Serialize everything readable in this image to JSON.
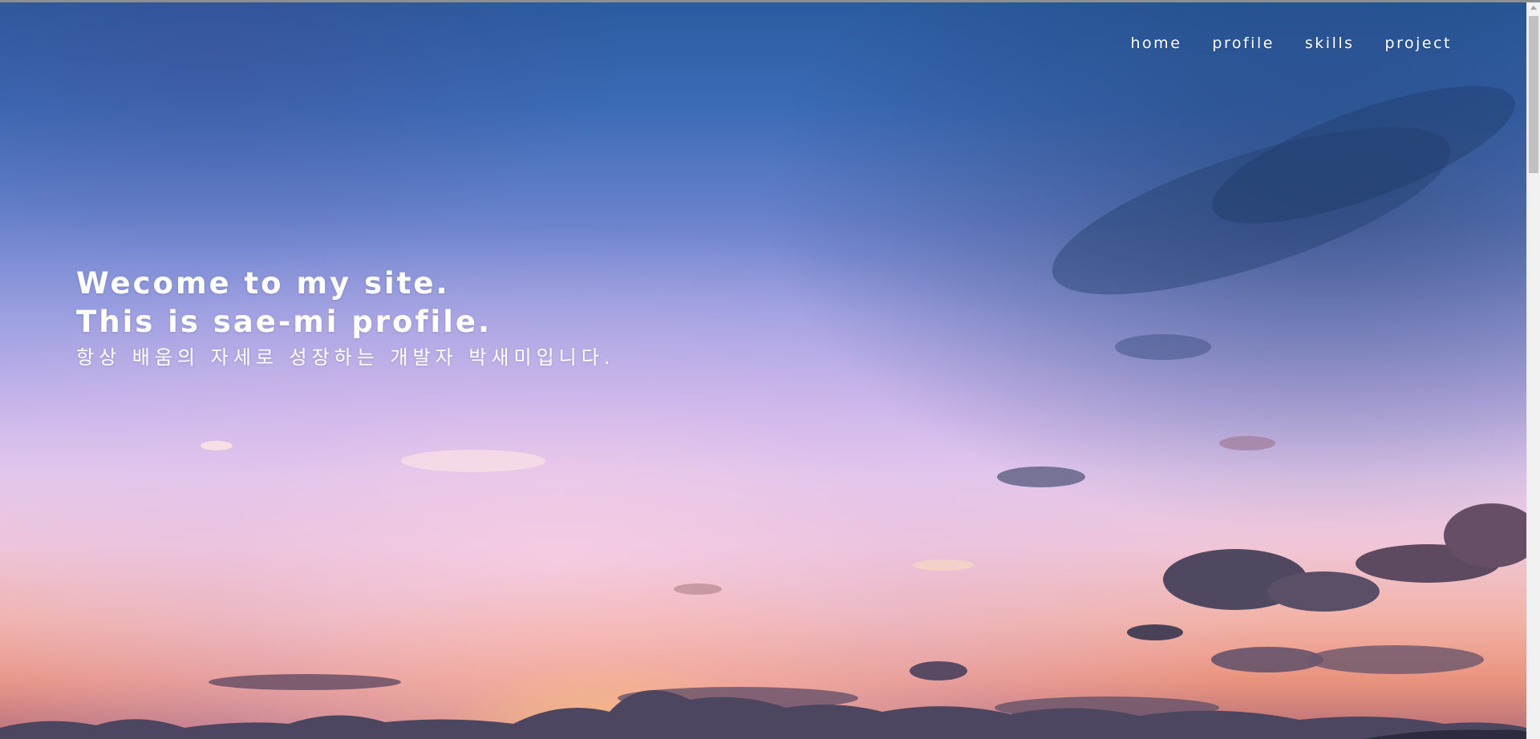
{
  "nav": {
    "items": [
      {
        "label": "home"
      },
      {
        "label": "profile"
      },
      {
        "label": "skills"
      },
      {
        "label": "project"
      }
    ]
  },
  "intro": {
    "line1": "Wecome to my site.",
    "line2": "This is sae-mi profile.",
    "subtitle": "항상 배움의 자세로 성장하는 개발자 박새미입니다."
  },
  "colors": {
    "text": "#ffffff",
    "sky_top": "#2b5b9f",
    "sky_mid": "#c3b3ea",
    "sky_horizon": "#f2b2a6",
    "cloud_dark": "#4a4258"
  }
}
